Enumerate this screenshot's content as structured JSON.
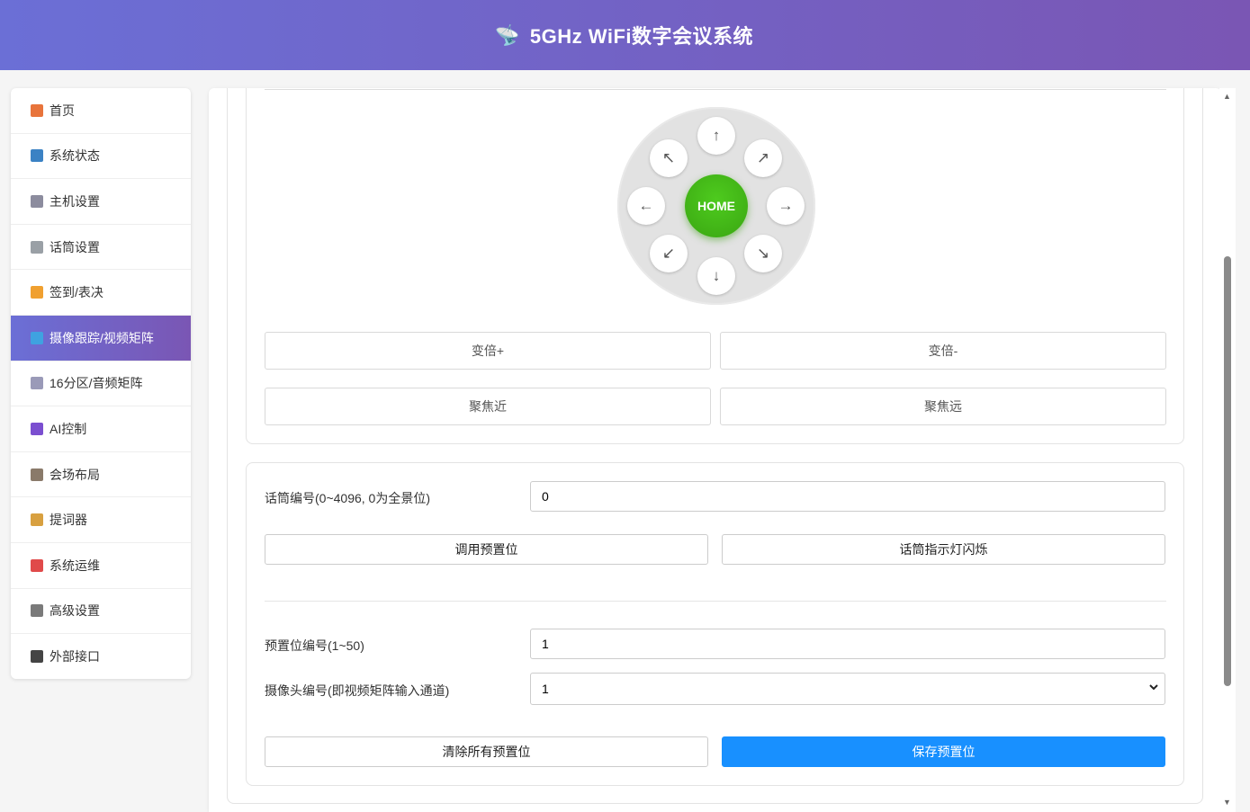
{
  "header": {
    "logo_icon": "satellite-dish-icon",
    "logo_glyph": "📡",
    "title": "5GHz WiFi数字会议系统"
  },
  "sidebar": {
    "items": [
      {
        "label": "首页",
        "icon": "house-icon",
        "color": "#e8743b"
      },
      {
        "label": "系统状态",
        "icon": "bar-chart-icon",
        "color": "#3b82c4"
      },
      {
        "label": "主机设置",
        "icon": "gear-icon",
        "color": "#8c8c9e"
      },
      {
        "label": "话筒设置",
        "icon": "microphone-icon",
        "color": "#9aa0a6"
      },
      {
        "label": "签到/表决",
        "icon": "raised-hand-icon",
        "color": "#f0a030"
      },
      {
        "label": "摄像跟踪/视频矩阵",
        "icon": "camera-icon",
        "color": "#3fa2e0",
        "active": true
      },
      {
        "label": "16分区/音频矩阵",
        "icon": "speaker-icon",
        "color": "#9a9ab8"
      },
      {
        "label": "AI控制",
        "icon": "robot-icon",
        "color": "#7b4fd0"
      },
      {
        "label": "会场布局",
        "icon": "building-icon",
        "color": "#8a7a6a"
      },
      {
        "label": "提词器",
        "icon": "scroll-icon",
        "color": "#d8a040"
      },
      {
        "label": "系统运维",
        "icon": "rocket-icon",
        "color": "#e04a4a"
      },
      {
        "label": "高级设置",
        "icon": "tools-icon",
        "color": "#7a7a7a"
      },
      {
        "label": "外部接口",
        "icon": "plug-icon",
        "color": "#444444"
      }
    ]
  },
  "ptz": {
    "home_label": "HOME",
    "arrows": {
      "up": "↑",
      "up_right": "↗",
      "right": "→",
      "down_right": "↘",
      "down": "↓",
      "down_left": "↙",
      "left": "←",
      "up_left": "↖"
    },
    "zoom_in": "变倍+",
    "zoom_out": "变倍-",
    "focus_near": "聚焦近",
    "focus_far": "聚焦远"
  },
  "preset": {
    "mic_label": "话筒编号(0~4096, 0为全景位)",
    "mic_value": "0",
    "call_preset": "调用预置位",
    "flash_indicator": "话筒指示灯闪烁",
    "preset_label": "预置位编号(1~50)",
    "preset_value": "1",
    "camera_label": "摄像头编号(即视频矩阵输入通道)",
    "camera_value": "1",
    "clear_all": "清除所有预置位",
    "save_preset": "保存预置位"
  },
  "colors": {
    "accent": "#6b6fd6",
    "primary": "#1890ff",
    "home": "#3aa612"
  }
}
